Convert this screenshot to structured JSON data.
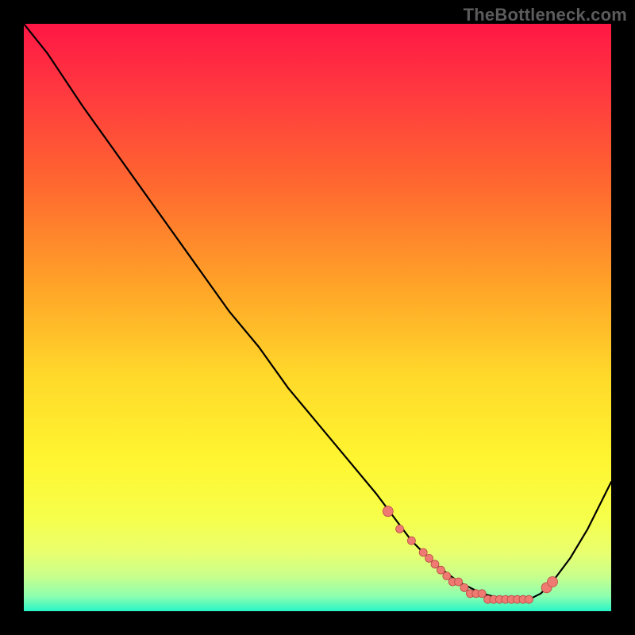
{
  "watermark": "TheBottleneck.com",
  "colors": {
    "frame": "#000000",
    "curve": "#000000",
    "marker_fill": "#ef7a72",
    "marker_stroke": "#b84c47",
    "gradient_stops": [
      {
        "offset": 0.0,
        "color": "#ff1745"
      },
      {
        "offset": 0.12,
        "color": "#ff3a3f"
      },
      {
        "offset": 0.28,
        "color": "#ff6a2f"
      },
      {
        "offset": 0.45,
        "color": "#ffa528"
      },
      {
        "offset": 0.6,
        "color": "#ffd92a"
      },
      {
        "offset": 0.74,
        "color": "#fff530"
      },
      {
        "offset": 0.84,
        "color": "#f6ff4a"
      },
      {
        "offset": 0.9,
        "color": "#e9ff6e"
      },
      {
        "offset": 0.94,
        "color": "#c9ff8c"
      },
      {
        "offset": 0.975,
        "color": "#8cffb0"
      },
      {
        "offset": 1.0,
        "color": "#29f5c6"
      }
    ]
  },
  "chart_data": {
    "type": "line",
    "title": "",
    "xlabel": "",
    "ylabel": "",
    "xlim": [
      0,
      100
    ],
    "ylim": [
      0,
      100
    ],
    "series": [
      {
        "name": "curve",
        "x": [
          0,
          4,
          6,
          10,
          15,
          20,
          25,
          30,
          35,
          40,
          45,
          50,
          55,
          60,
          63,
          66,
          70,
          74,
          78,
          82,
          86,
          88,
          90,
          93,
          96,
          100
        ],
        "y": [
          100,
          95,
          92,
          86,
          79,
          72,
          65,
          58,
          51,
          45,
          38,
          32,
          26,
          20,
          16,
          12,
          8,
          5,
          3,
          2,
          2,
          3,
          5,
          9,
          14,
          22
        ]
      }
    ],
    "markers": {
      "name": "highlight-points",
      "x": [
        62,
        64,
        66,
        68,
        69,
        70,
        71,
        72,
        73,
        74,
        75,
        76,
        77,
        78,
        79,
        80,
        81,
        82,
        83,
        84,
        85,
        86,
        89,
        90
      ],
      "y": [
        17,
        14,
        12,
        10,
        9,
        8,
        7,
        6,
        5,
        5,
        4,
        3,
        3,
        3,
        2,
        2,
        2,
        2,
        2,
        2,
        2,
        2,
        4,
        5
      ]
    }
  }
}
